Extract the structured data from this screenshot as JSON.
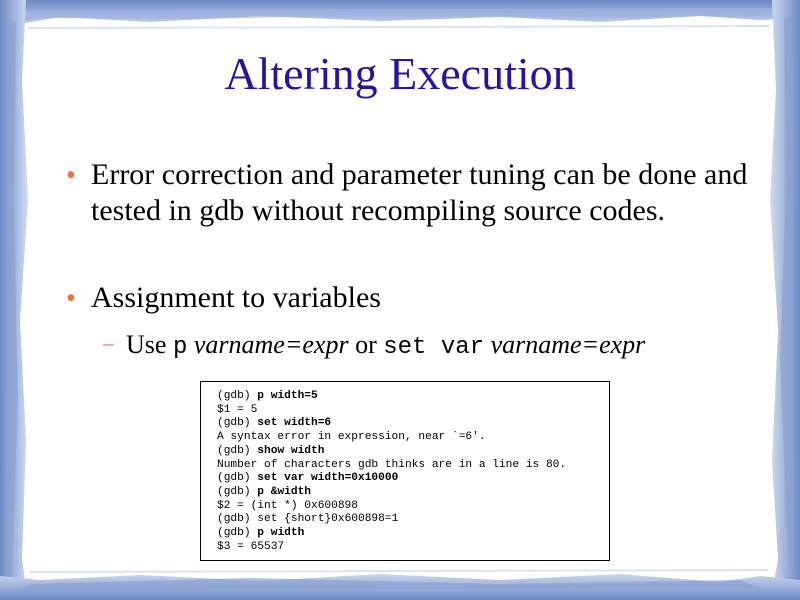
{
  "slide": {
    "title": "Altering Execution",
    "bullets": [
      {
        "text": "Error correction and parameter tuning can be done and tested in gdb without recompiling source codes."
      },
      {
        "text": "Assignment to variables"
      }
    ],
    "sub_bullet": {
      "prefix": "Use ",
      "cmd1": "p",
      "expr1": "varname=expr",
      "middle": " or ",
      "cmd2": "set var",
      "expr2": "varname=expr"
    },
    "code_lines": [
      {
        "prompt": "(gdb) ",
        "cmd": "p width=5",
        "bold": true
      },
      {
        "prompt": "",
        "cmd": "$1 = 5",
        "bold": false
      },
      {
        "prompt": "(gdb) ",
        "cmd": "set width=6",
        "bold": true
      },
      {
        "prompt": "",
        "cmd": "A syntax error in expression, near `=6'.",
        "bold": false
      },
      {
        "prompt": "(gdb) ",
        "cmd": "show width",
        "bold": true
      },
      {
        "prompt": "",
        "cmd": "Number of characters gdb thinks are in a line is 80.",
        "bold": false
      },
      {
        "prompt": "(gdb) ",
        "cmd": "set var width=0x10000",
        "bold": true
      },
      {
        "prompt": "(gdb) ",
        "cmd": "p &width",
        "bold": true
      },
      {
        "prompt": "",
        "cmd": "$2 = (int *) 0x600898",
        "bold": false
      },
      {
        "prompt": "(gdb) ",
        "cmd": "set {short}0x600898=1",
        "bold": false
      },
      {
        "prompt": "(gdb) ",
        "cmd": "p width",
        "bold": true
      },
      {
        "prompt": "",
        "cmd": "$3 = 65537",
        "bold": false
      }
    ],
    "colors": {
      "title": "#2a12a0",
      "bullet": "#f07040",
      "frame": "#7f99cc"
    }
  }
}
